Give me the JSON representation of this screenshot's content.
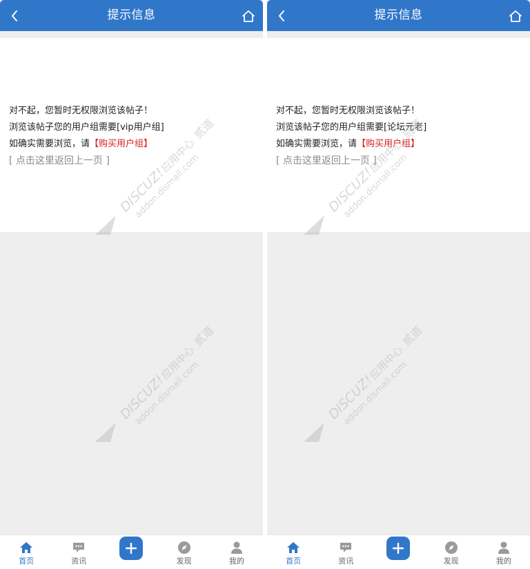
{
  "colors": {
    "brand": "#3177c9",
    "link_red": "#d61d1d",
    "muted": "#8a8a8a"
  },
  "screens": [
    {
      "header": {
        "title": "提示信息",
        "back_icon": "chevron-left-icon",
        "home_icon": "home-icon"
      },
      "message": {
        "line1": "对不起，您暂时无权限浏览该帖子！",
        "line2": "浏览该帖子您的用户组需要[vip用户组]",
        "line3_prefix": "如确实需要浏览，请",
        "buy_link": "【购买用户组】",
        "back_link": "[ 点击这里返回上一页 ]"
      },
      "watermark": {
        "brand": "DISCUZ!",
        "cn": "应用中心",
        "domain": "addon.dismall.com",
        "partner": "贰道"
      },
      "tabbar": [
        {
          "label": "首页",
          "icon": "home-filled-icon",
          "active": true
        },
        {
          "label": "资讯",
          "icon": "chat-bubble-icon",
          "active": false
        },
        {
          "label": "",
          "icon": "plus-icon",
          "active": false
        },
        {
          "label": "发现",
          "icon": "compass-icon",
          "active": false
        },
        {
          "label": "我的",
          "icon": "user-icon",
          "active": false
        }
      ]
    },
    {
      "header": {
        "title": "提示信息",
        "back_icon": "chevron-left-icon",
        "home_icon": "home-icon"
      },
      "message": {
        "line1": "对不起，您暂时无权限浏览该帖子！",
        "line2": "浏览该帖子您的用户组需要[论坛元老]",
        "line3_prefix": "如确实需要浏览，请",
        "buy_link": "【购买用户组】",
        "back_link": "[ 点击这里返回上一页 ]"
      },
      "watermark": {
        "brand": "DISCUZ!",
        "cn": "应用中心",
        "domain": "addon.dismall.com",
        "partner": "贰道"
      },
      "tabbar": [
        {
          "label": "首页",
          "icon": "home-filled-icon",
          "active": true
        },
        {
          "label": "资讯",
          "icon": "chat-bubble-icon",
          "active": false
        },
        {
          "label": "",
          "icon": "plus-icon",
          "active": false
        },
        {
          "label": "发现",
          "icon": "compass-icon",
          "active": false
        },
        {
          "label": "我的",
          "icon": "user-icon",
          "active": false
        }
      ]
    }
  ]
}
